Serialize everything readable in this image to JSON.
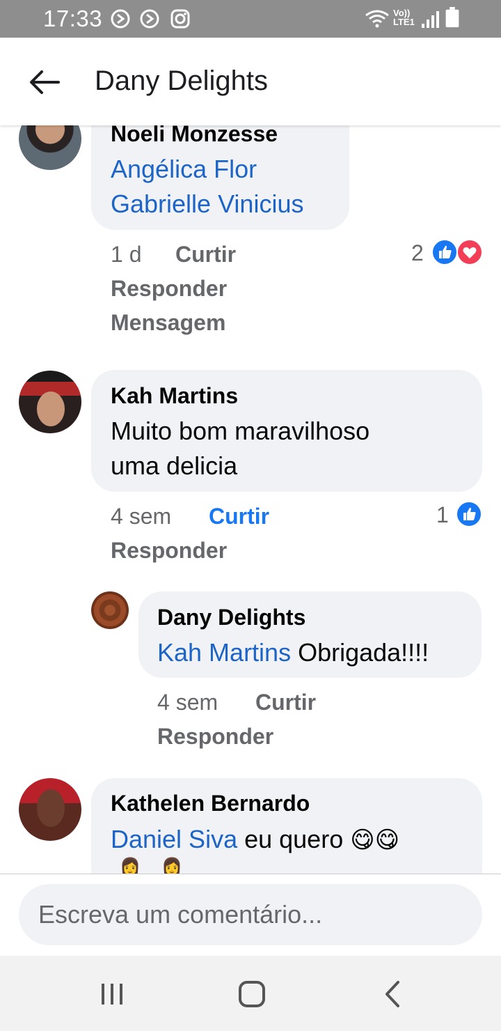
{
  "status_bar": {
    "time": "17:33",
    "icons": [
      "media-sync-icon",
      "media-sync-icon",
      "instagram-icon",
      "wifi-icon",
      "volte-icon",
      "signal-icon",
      "battery-icon"
    ],
    "network_label": "Vo)) LTE1"
  },
  "header": {
    "title": "Dany Delights",
    "back_icon": "arrow-left-icon"
  },
  "comments": [
    {
      "author": "Noeli Monzesse",
      "text_lines": [
        {
          "mention": "Angélica Flor",
          "text": ""
        },
        {
          "mention": "Gabrielle Vinicius",
          "text": ""
        }
      ],
      "time": "1 d",
      "like_label": "Curtir",
      "reply_label": "Responder",
      "message_label": "Mensagem",
      "reaction_count": "2",
      "reactions": [
        "like-icon",
        "love-icon"
      ]
    },
    {
      "author": "Kah Martins",
      "text_lines": [
        "Muito bom maravilhoso",
        "uma delicia"
      ],
      "time": "4 sem",
      "like_label": "Curtir",
      "reply_label": "Responder",
      "reaction_count": "1",
      "reactions": [
        "like-icon"
      ],
      "liked": true
    },
    {
      "author": "Dany Delights",
      "is_reply": true,
      "mention": "Kah Martins",
      "text": " Obrigada!!!!",
      "time": "4 sem",
      "like_label": "Curtir",
      "reply_label": "Responder"
    },
    {
      "author": "Kathelen Bernardo",
      "mention": "Daniel Siva",
      "text": " eu quero",
      "emojis": [
        "😋",
        "😋"
      ],
      "second_line_emojis": [
        "👩",
        "👩"
      ]
    }
  ],
  "composer": {
    "placeholder": "Escreva um comentário..."
  },
  "nav": {
    "recents_icon": "recents-icon",
    "home_icon": "home-icon",
    "back_icon": "back-chevron-icon"
  },
  "colors": {
    "link": "#1d64c7",
    "like_blue": "#1877f2",
    "love_red": "#f33e58",
    "bubble": "#f0f2f5",
    "meta_grey": "#65676b"
  }
}
